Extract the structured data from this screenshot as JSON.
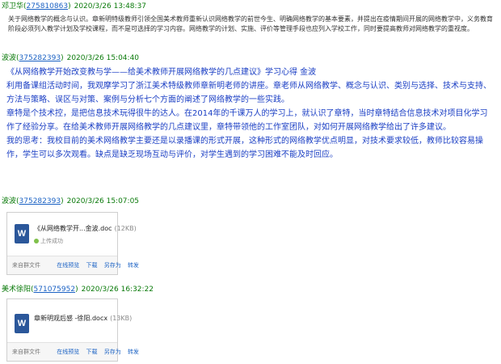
{
  "messages": [
    {
      "sender": "邓卫华",
      "qq": "275810863",
      "time": "2020/3/26 13:48:37",
      "text": "关于网络教学的概念与认识。章新明特级教师引领全国美术教师重新认识网络教学的前世今生、明确网络教学的基本要素，并提出在疫情期间开展的网络教学中，义务教育阶段必须列入教学计划及学校课程，而不是可选择的学习内容。网络教学的计划、实施、评价等管理手段也应列入学校工作，同时要提高教师对网络教学的重视度。"
    },
    {
      "sender": "波波",
      "qq": "375282393",
      "time": "2020/3/26 15:04:40",
      "lines": [
        "《从网络教学开始改变教与学——给美术教师开展网络教学的几点建议》学习心得 金波",
        "利用备课组活动时间，我观摩学习了浙江美术特级教师章新明老师的讲座。章老师从网络教学、概念与认识、类别与选择、技术与支持、方法与策略、误区与对策、案例与分析七个方面的阐述了网络教学的一些实践。",
        "章特是个技术控，是把信息技术玩得很牛的达人。在2014年的千课万人的学习上，就认识了章特，当时章特结合信息技术对项目化学习作了经验分享。在给美术教师开展网络教学的几点建议里，章特带领他的工作室团队，对如何开展网络教学给出了许多建议。",
        "我的思考：我校目前的美术网络教学主要还是以录播课的形式开展，这种形式的网络教学优点明显，对技术要求较低，教师比较容易操作，学生可以多次观看。缺点是缺乏现场互动与评价，对学生遇到的学习困难不能及时回应。"
      ]
    },
    {
      "sender": "波波",
      "qq": "375282393",
      "time": "2020/3/26 15:07:05",
      "file": {
        "icon": "W",
        "name": "《从网络教学开...金波.doc",
        "size": "(12KB)",
        "status": "上传成功",
        "source": "来自群文件",
        "actions": [
          "在线预览",
          "下载",
          "另存为",
          "转发"
        ]
      }
    },
    {
      "sender": "美术徐阳",
      "qq": "571075952",
      "time": "2020/3/26 16:32:22",
      "file": {
        "icon": "W",
        "name": "章新明观后感 -徐阳.docx",
        "size": "(13KB)",
        "status": "",
        "source": "来自群文件",
        "actions": [
          "在线预览",
          "下载",
          "另存为",
          "转发"
        ]
      }
    }
  ]
}
